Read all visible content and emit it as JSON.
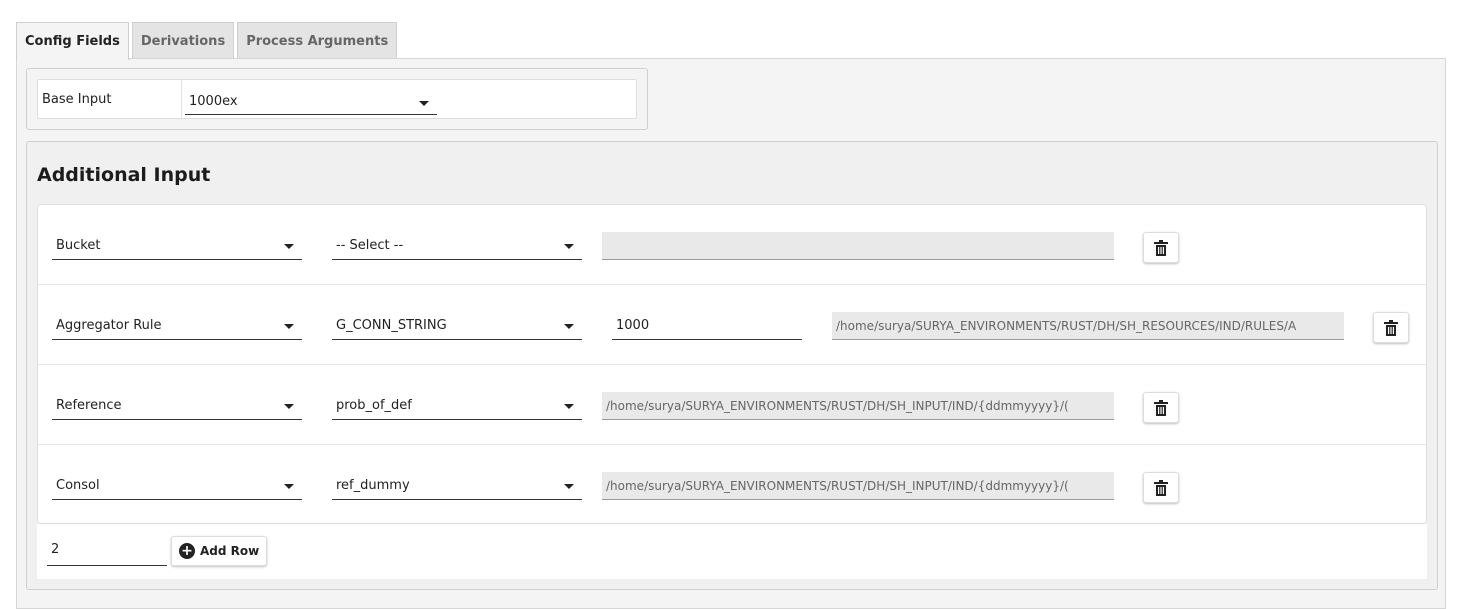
{
  "tabs": [
    {
      "label": "Config Fields",
      "active": true
    },
    {
      "label": "Derivations",
      "active": false
    },
    {
      "label": "Process Arguments",
      "active": false
    }
  ],
  "base_input": {
    "label": "Base Input",
    "value": "1000ex"
  },
  "additional_input": {
    "title": "Additional Input",
    "rows": [
      {
        "type": "Bucket",
        "source": "-- Select --",
        "path": ""
      },
      {
        "type": "Aggregator Rule",
        "source": "G_CONN_STRING",
        "value": "1000",
        "path": "/home/surya/SURYA_ENVIRONMENTS/RUST/DH/SH_RESOURCES/IND/RULES/A"
      },
      {
        "type": "Reference",
        "source": "prob_of_def",
        "path": "/home/surya/SURYA_ENVIRONMENTS/RUST/DH/SH_INPUT/IND/{ddmmyyyy}/("
      },
      {
        "type": "Consol",
        "source": "ref_dummy",
        "path": "/home/surya/SURYA_ENVIRONMENTS/RUST/DH/SH_INPUT/IND/{ddmmyyyy}/("
      }
    ],
    "row_count": "2",
    "add_row_label": "Add Row"
  },
  "icons": {
    "delete": "trash-icon",
    "add": "plus-circle-icon",
    "dropdown": "caret-down-icon"
  }
}
